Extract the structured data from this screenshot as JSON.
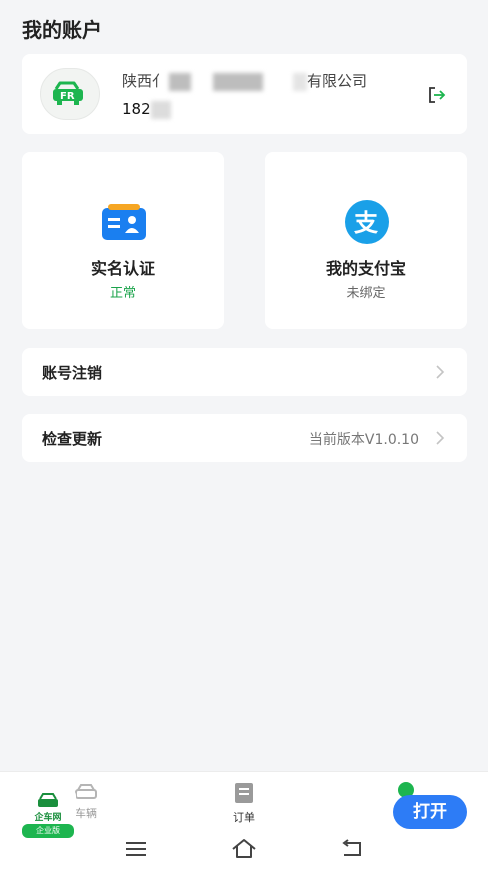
{
  "header": {
    "title": "我的账户"
  },
  "account": {
    "company_prefix": "陕西亻",
    "company_suffix": "有限公司",
    "phone_prefix": "182"
  },
  "features": [
    {
      "title": "实名认证",
      "status": "正常",
      "status_color": "#1aa34a"
    },
    {
      "title": "我的支付宝",
      "status": "未绑定",
      "status_color": "#666666"
    }
  ],
  "rows": {
    "cancel_account": {
      "label": "账号注销"
    },
    "check_update": {
      "label": "检查更新",
      "value": "当前版本V1.0.10"
    }
  },
  "bottom_nav": {
    "home_brand": "企车网",
    "home_badge": "企业版",
    "vehicles_label": "车辆",
    "orders_label": "订单",
    "open_button": "打开"
  },
  "colors": {
    "accent_green": "#1db54f",
    "button_blue": "#2d7cf6",
    "alipay_blue": "#1aa0e8",
    "card_blue": "#1a7ff0"
  }
}
